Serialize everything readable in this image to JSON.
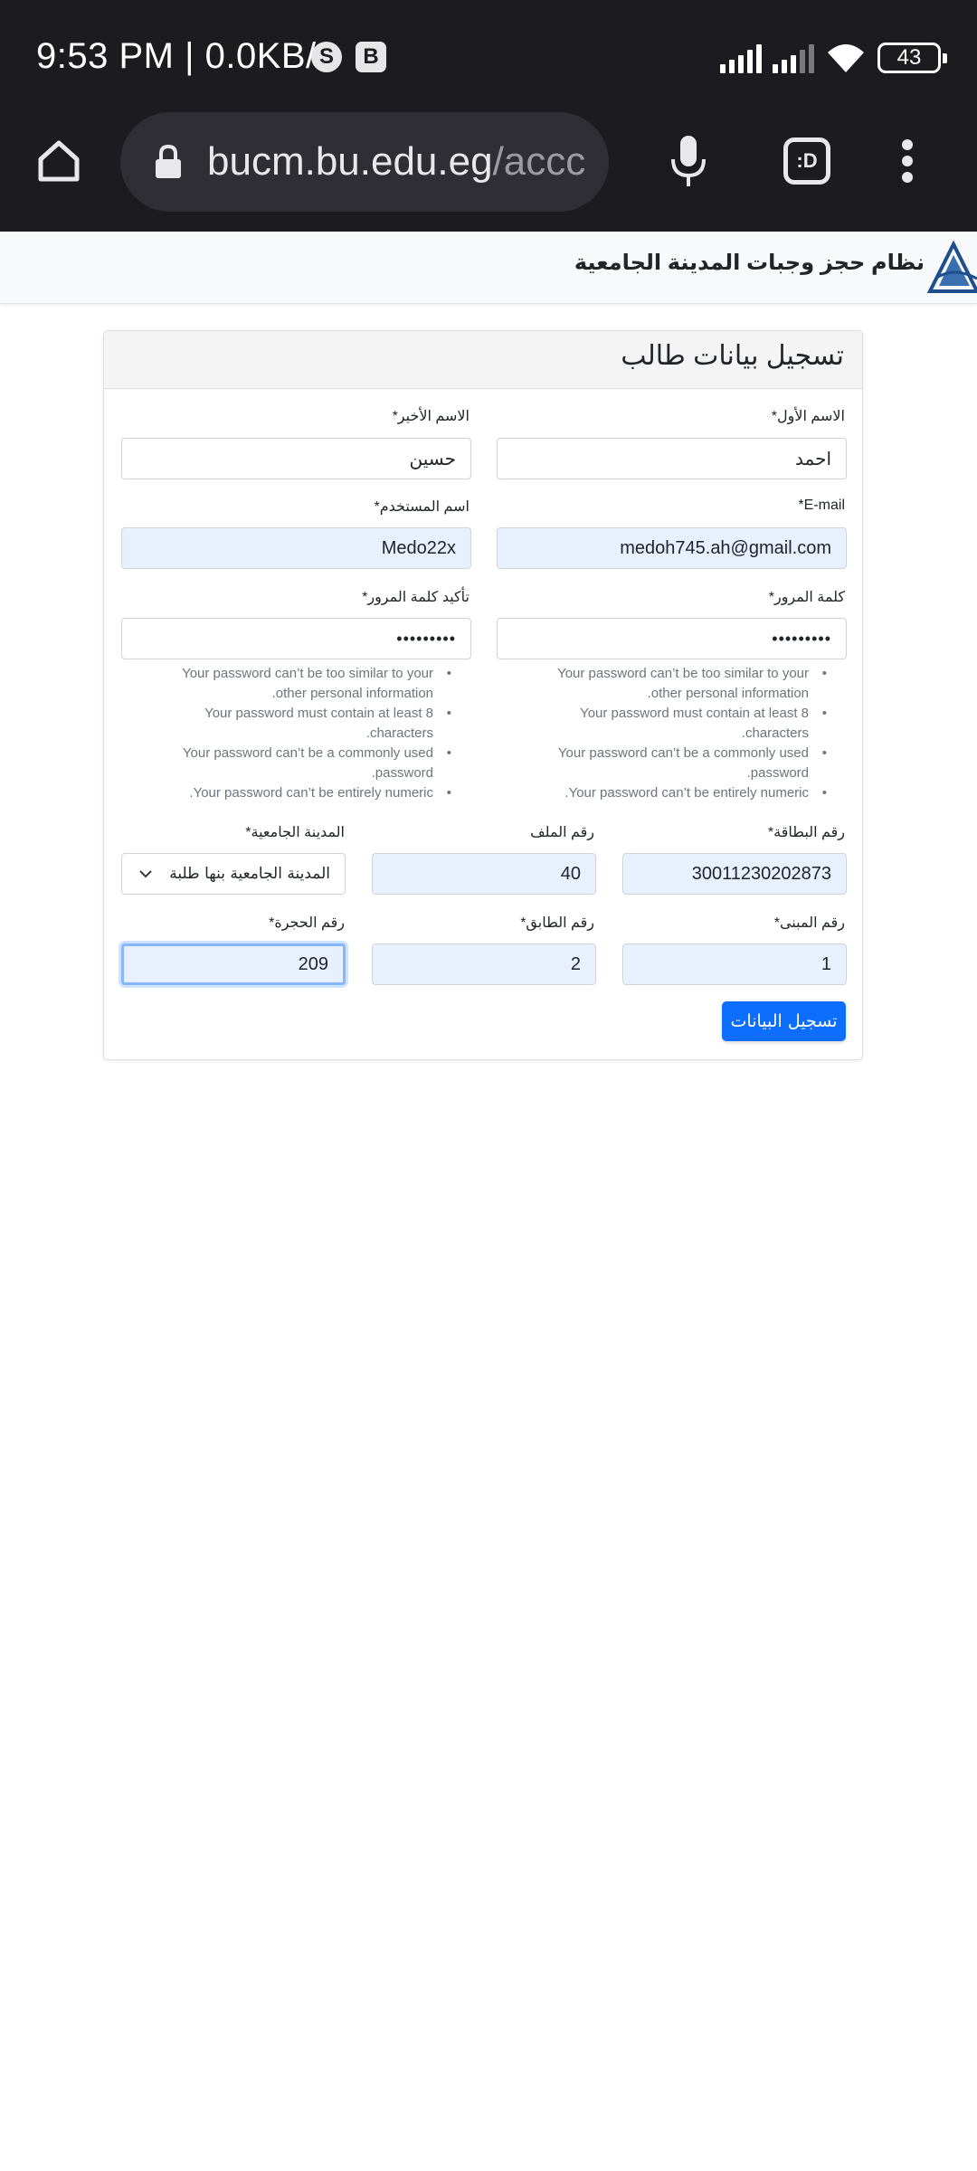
{
  "status_bar": {
    "time": "9:53 PM | 0.0KB/s",
    "app_icon_1": "S",
    "app_icon_2": "B",
    "battery": "43"
  },
  "browser": {
    "url_main": "bucm.bu.edu.eg",
    "url_rest": "/accc",
    "tabs_label": ":D"
  },
  "navbar": {
    "brand": "نظام حجز وجبات المدينة الجامعية"
  },
  "card": {
    "title": "تسجيل بيانات طالب"
  },
  "form": {
    "first_name": {
      "label": "الاسم الأول*",
      "value": "احمد"
    },
    "last_name": {
      "label": "الاسم الأخير*",
      "value": "حسين"
    },
    "email": {
      "label": "E-mail*",
      "value": "medoh745.ah@gmail.com"
    },
    "username": {
      "label": "اسم المستخدم*",
      "value": "Medo22x"
    },
    "password": {
      "label": "كلمة المرور*",
      "value": "•••••••••"
    },
    "password_confirm": {
      "label": "تأكيد كلمة المرور*",
      "value": "•••••••••"
    },
    "password_help": [
      "Your password can’t be too similar to your other personal information.",
      "Your password must contain at least 8 characters.",
      "Your password can’t be a commonly used password.",
      "Your password can’t be entirely numeric."
    ],
    "card_number": {
      "label": "رقم البطاقة*",
      "value": "30011230202873"
    },
    "file_number": {
      "label": "رقم الملف",
      "value": "40"
    },
    "university_city": {
      "label": "المدينة الجامعية*",
      "value": "المدينة الجامعية بنها طلبة"
    },
    "building_number": {
      "label": "رقم المبنى*",
      "value": "1"
    },
    "floor_number": {
      "label": "رقم الطابق*",
      "value": "2"
    },
    "room_number": {
      "label": "رقم الحجرة*",
      "value": "209"
    }
  },
  "submit_label": "تسجيل البيانات",
  "colors": {
    "primary": "#0d6efd",
    "autofill_bg": "#e8f0fe",
    "system_bar": "#1c1c20"
  },
  "icons": [
    "home-icon",
    "lock-icon",
    "mic-icon",
    "tabs-icon",
    "more-icon",
    "wifi-icon",
    "signal-icon",
    "battery-icon",
    "chevron-down-icon",
    "university-logo-icon"
  ]
}
